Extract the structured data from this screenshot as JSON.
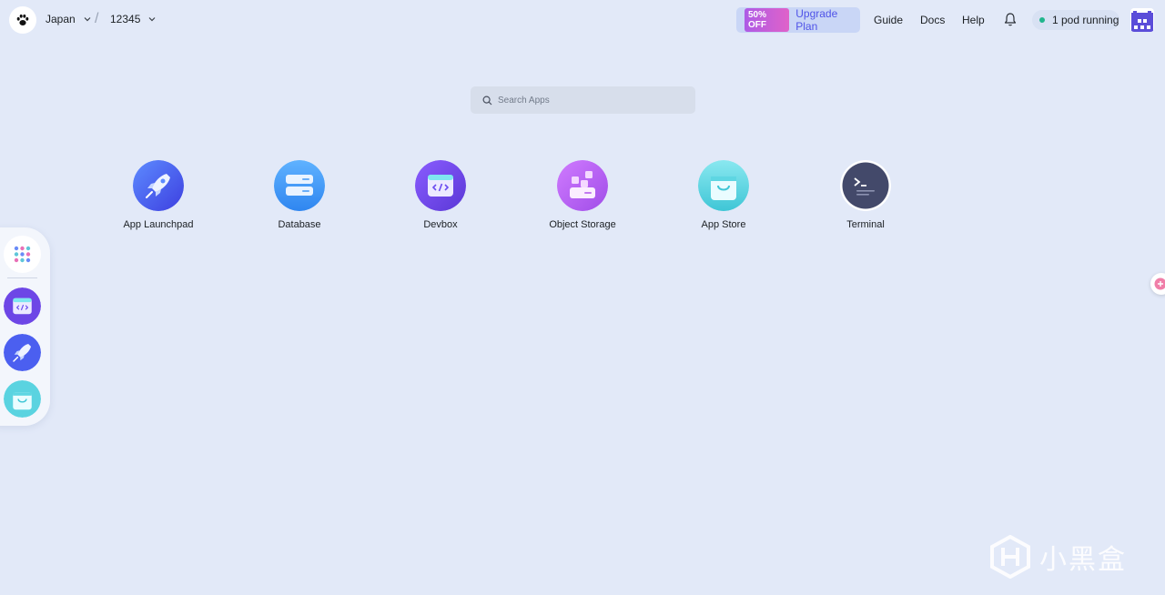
{
  "topbar": {
    "logo_icon": "paw-logo-icon",
    "region": "Japan",
    "workspace": "12345",
    "upgrade": {
      "badge": "50% OFF",
      "label": "Upgrade Plan"
    },
    "links": {
      "guide": "Guide",
      "docs": "Docs",
      "help": "Help"
    },
    "notification_icon": "bell-icon",
    "pods_status": "1 pod running",
    "status_color": "#20b58c"
  },
  "search": {
    "placeholder": "Search Apps",
    "value": ""
  },
  "apps": [
    {
      "label": "App Launchpad",
      "icon": "rocket-icon"
    },
    {
      "label": "Database",
      "icon": "database-icon"
    },
    {
      "label": "Devbox",
      "icon": "devbox-code-icon"
    },
    {
      "label": "Object Storage",
      "icon": "object-storage-icon"
    },
    {
      "label": "App Store",
      "icon": "shopping-bag-icon"
    },
    {
      "label": "Terminal",
      "icon": "terminal-icon"
    }
  ],
  "dock": [
    "apps-grid-icon",
    "devbox-code-icon",
    "rocket-icon",
    "shopping-bag-icon"
  ],
  "watermark": {
    "text": "小黑盒"
  },
  "colors": {
    "background": "#e2e9f8",
    "accent": "#4f53e8"
  }
}
